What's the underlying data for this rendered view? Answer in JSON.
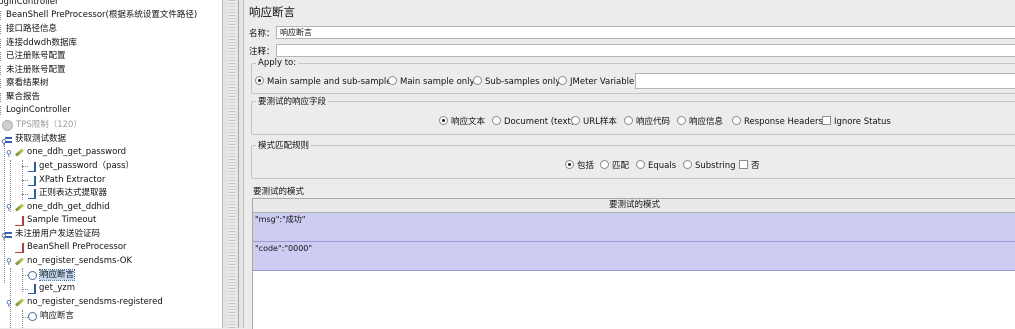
{
  "tree": {
    "items": [
      {
        "label": "loginController",
        "icon": "tree-leaf-icon"
      },
      {
        "label": "BeanShell PreProcessor(根据系统设置文件路径)",
        "icon": "tree-leaf-icon"
      },
      {
        "label": "接口路径信息",
        "icon": "tree-leaf-icon"
      },
      {
        "label": "连接ddwdh数据库",
        "icon": "tree-leaf-icon"
      },
      {
        "label": "已注册账号配置",
        "icon": "tree-leaf-icon"
      },
      {
        "label": "未注册账号配置",
        "icon": "tree-leaf-icon"
      },
      {
        "label": "察看结果树",
        "icon": "tree-leaf-icon"
      },
      {
        "label": "聚合报告",
        "icon": "tree-leaf-icon"
      },
      {
        "label": "LoginController",
        "icon": "tree-leaf-icon"
      },
      {
        "label": "TPS限制（120）",
        "icon": "timer-icon"
      },
      {
        "label": "获取测试数据",
        "icon": "thread-group-icon"
      },
      {
        "label": "one_ddh_get_password",
        "icon": "sampler-icon"
      },
      {
        "label": "get_password（pass）",
        "icon": "extractor-icon"
      },
      {
        "label": "XPath Extractor",
        "icon": "extractor-icon"
      },
      {
        "label": "正则表达式提取器",
        "icon": "extractor-icon"
      },
      {
        "label": "one_ddh_get_ddhid",
        "icon": "sampler-icon"
      },
      {
        "label": "Sample Timeout",
        "icon": "preprocessor-icon"
      },
      {
        "label": "未注册用户发送验证码",
        "icon": "thread-group-icon"
      },
      {
        "label": "BeanShell PreProcessor",
        "icon": "preprocessor-icon"
      },
      {
        "label": "no_register_sendsms-OK",
        "icon": "sampler-icon"
      },
      {
        "label": "响应断言",
        "icon": "assertion-icon"
      },
      {
        "label": "get_yzm",
        "icon": "extractor-icon"
      },
      {
        "label": "no_register_sendsms-registered",
        "icon": "sampler-icon"
      },
      {
        "label": "响应断言",
        "icon": "assertion-icon"
      }
    ]
  },
  "panel": {
    "title": "响应断言",
    "name_label": "名称：",
    "name_value": "响应断言",
    "comment_label": "注释：",
    "comment_value": "",
    "apply_to": {
      "legend": "Apply to:",
      "options": [
        "Main sample and sub-samples",
        "Main sample only",
        "Sub-samples only",
        "JMeter Variable"
      ],
      "selected": "Main sample and sub-samples",
      "variable_value": ""
    },
    "field_to_test": {
      "legend": "要测试的响应字段",
      "options": [
        "响应文本",
        "Document (text)",
        "URL样本",
        "响应代码",
        "响应信息",
        "Response Headers"
      ],
      "selected": "响应文本",
      "ignore_status_label": "Ignore Status",
      "ignore_status_checked": false
    },
    "matching_rules": {
      "legend": "模式匹配规则",
      "options": [
        "包括",
        "匹配",
        "Equals",
        "Substring"
      ],
      "selected": "包括",
      "not_label": "否",
      "not_checked": false
    },
    "patterns": {
      "legend": "要测试的模式",
      "column_header": "要测试的模式",
      "rows": [
        "\"msg\":\"成功\"",
        "\"code\":\"0000\""
      ]
    }
  }
}
